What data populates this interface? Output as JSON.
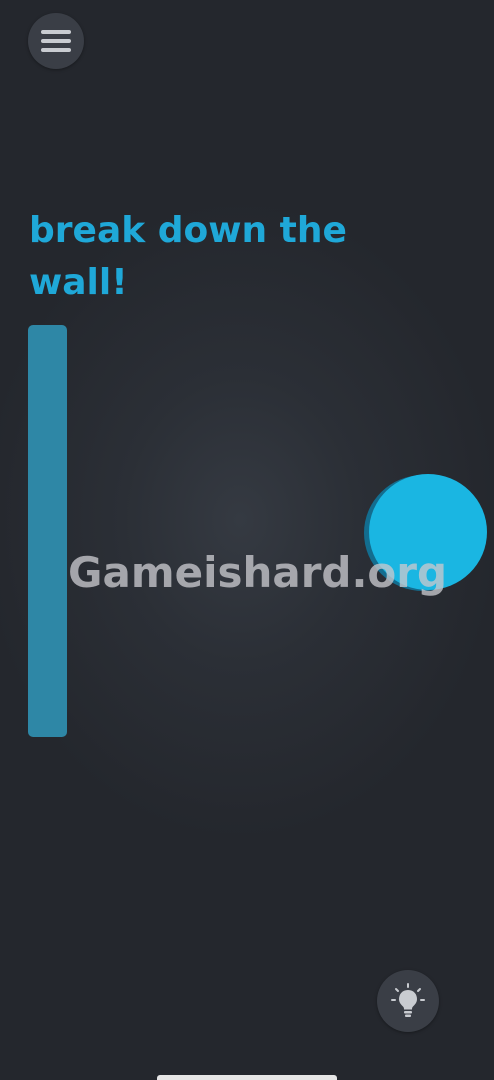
{
  "level": {
    "title": "break down the wall!"
  },
  "watermark": {
    "text": "Gameishard.org"
  },
  "icons": {
    "menu": "hamburger-menu-icon",
    "hint": "lightbulb-icon"
  },
  "colors": {
    "background": "#2b2f36",
    "title": "#1fa8d8",
    "wall": "#2e87a6",
    "ball": "#1ab6e2",
    "button": "#3a3e46"
  }
}
